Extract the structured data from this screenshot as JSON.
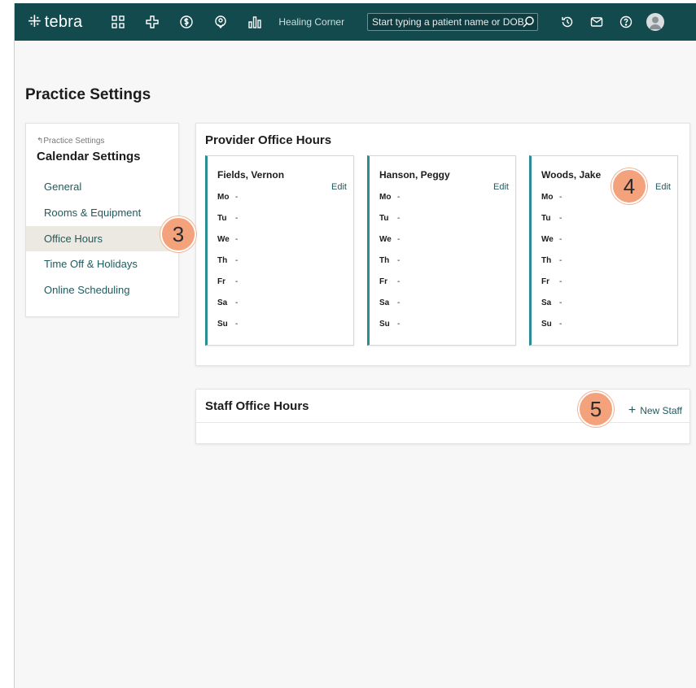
{
  "topbar": {
    "logo_text": "tebra",
    "practice_name": "Healing Corner",
    "search_placeholder": "Start typing a patient name or DOB",
    "nav_icons": [
      "dashboard-grid-icon",
      "medical-cross-icon",
      "billing-dollar-icon",
      "location-icon",
      "reports-chart-icon"
    ],
    "right_icons": [
      "history-icon",
      "mail-icon",
      "help-icon",
      "user-avatar"
    ]
  },
  "page": {
    "title": "Practice Settings"
  },
  "sidebar": {
    "breadcrumb": "Practice Settings",
    "heading": "Calendar Settings",
    "items": [
      {
        "label": "General"
      },
      {
        "label": "Rooms & Equipment"
      },
      {
        "label": "Office Hours"
      },
      {
        "label": "Time Off & Holidays"
      },
      {
        "label": "Online Scheduling"
      }
    ],
    "active_item": "Office Hours"
  },
  "provider_hours": {
    "title": "Provider Office Hours",
    "providers": [
      {
        "name": "Fields, Vernon",
        "edit_label": "Edit",
        "days": [
          {
            "day": "Mo",
            "hours": "-"
          },
          {
            "day": "Tu",
            "hours": "-"
          },
          {
            "day": "We",
            "hours": "-"
          },
          {
            "day": "Th",
            "hours": "-"
          },
          {
            "day": "Fr",
            "hours": "-"
          },
          {
            "day": "Sa",
            "hours": "-"
          },
          {
            "day": "Su",
            "hours": "-"
          }
        ]
      },
      {
        "name": "Hanson, Peggy",
        "edit_label": "Edit",
        "days": [
          {
            "day": "Mo",
            "hours": "-"
          },
          {
            "day": "Tu",
            "hours": "-"
          },
          {
            "day": "We",
            "hours": "-"
          },
          {
            "day": "Th",
            "hours": "-"
          },
          {
            "day": "Fr",
            "hours": "-"
          },
          {
            "day": "Sa",
            "hours": "-"
          },
          {
            "day": "Su",
            "hours": "-"
          }
        ]
      },
      {
        "name": "Woods, Jake",
        "edit_label": "Edit",
        "days": [
          {
            "day": "Mo",
            "hours": "-"
          },
          {
            "day": "Tu",
            "hours": "-"
          },
          {
            "day": "We",
            "hours": "-"
          },
          {
            "day": "Th",
            "hours": "-"
          },
          {
            "day": "Fr",
            "hours": "-"
          },
          {
            "day": "Sa",
            "hours": "-"
          },
          {
            "day": "Su",
            "hours": "-"
          }
        ]
      }
    ]
  },
  "staff_hours": {
    "title": "Staff Office Hours",
    "new_staff_label": "New Staff"
  },
  "callouts": {
    "c3": "3",
    "c4": "4",
    "c5": "5"
  },
  "colors": {
    "topbar": "#134a4e",
    "accent": "#2c8c94",
    "link": "#1f5a5e",
    "callout": "#f4a27c"
  }
}
